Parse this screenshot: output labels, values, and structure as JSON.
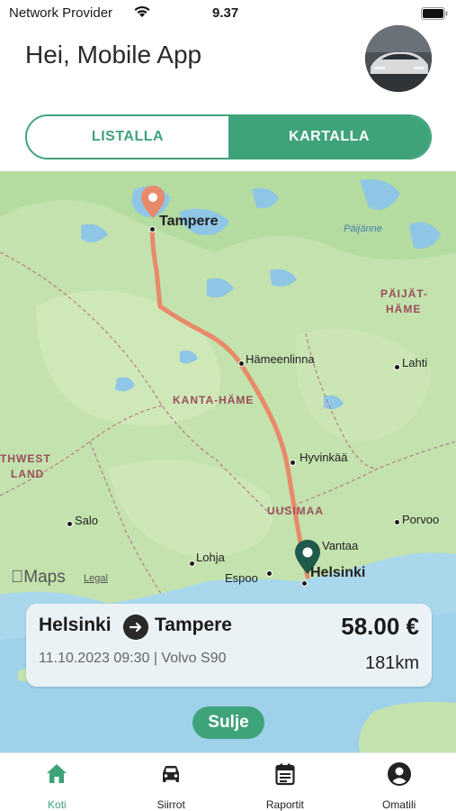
{
  "status_bar": {
    "carrier": "Network Provider",
    "time": "9.37"
  },
  "header": {
    "greeting": "Hei, Mobile App"
  },
  "view_toggle": {
    "list_label": "LISTALLA",
    "map_label": "KARTALLA",
    "selected": "KARTALLA"
  },
  "map": {
    "places": {
      "tampere": "Tampere",
      "hameenlinna": "Hämeenlinna",
      "lahti": "Lahti",
      "hyvinkaa": "Hyvinkää",
      "salo": "Salo",
      "lohja": "Lohja",
      "espoo": "Espoo",
      "vantaa": "Vantaa",
      "helsinki": "Helsinki",
      "porvoo": "Porvoo"
    },
    "regions": {
      "kanta_hame": "KANTA-HÄME",
      "uusimaa": "UUSIMAA",
      "paijat_hame_1": "PÄIJÄT-",
      "paijat_hame_2": "HÄME",
      "southwest_1": "THWEST",
      "southwest_2": "LAND"
    },
    "lakes": {
      "paijanne": "Päijänne"
    },
    "attribution": {
      "maps": "Maps",
      "legal": "Legal"
    },
    "route_color": "#e8896a",
    "destination_pin_color": "#e8896a",
    "origin_pin_color": "#1f5a4a"
  },
  "trip": {
    "from": "Helsinki",
    "to": "Tampere",
    "price": "58.00 €",
    "meta": "11.10.2023 09:30 | Volvo S90",
    "distance": "181km"
  },
  "close_button": {
    "label": "Sulje"
  },
  "tabbar": {
    "accent": "#3fa37a",
    "items": [
      {
        "label": "Koti",
        "icon": "home-icon",
        "active": true
      },
      {
        "label": "Siirrot",
        "icon": "car-icon",
        "active": false
      },
      {
        "label": "Raportit",
        "icon": "report-icon",
        "active": false
      },
      {
        "label": "Omatili",
        "icon": "account-icon",
        "active": false
      }
    ]
  }
}
